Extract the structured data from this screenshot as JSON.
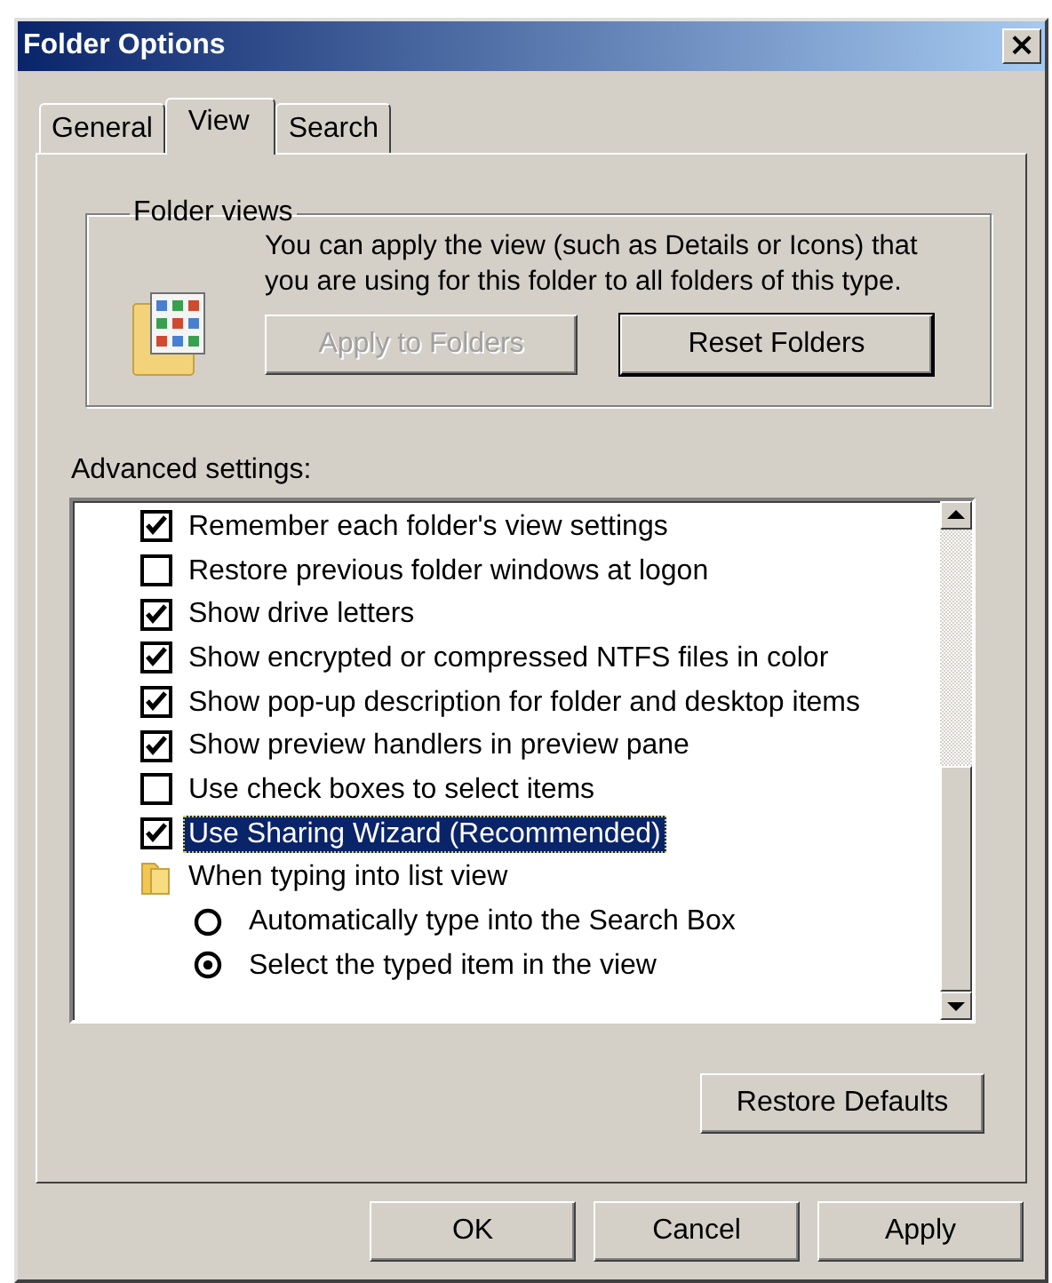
{
  "window": {
    "title": "Folder Options",
    "close": "×"
  },
  "tabs": [
    {
      "label": "General",
      "selected": false
    },
    {
      "label": "View",
      "selected": true
    },
    {
      "label": "Search",
      "selected": false
    }
  ],
  "folder_views": {
    "title": "Folder views",
    "description": "You can apply the view (such as Details or Icons) that you are using for this folder to all folders of this type.",
    "buttons": [
      {
        "label": "Apply to Folders",
        "disabled": true,
        "default": false
      },
      {
        "label": "Reset Folders",
        "disabled": false,
        "default": true
      }
    ]
  },
  "advanced": {
    "label": "Advanced settings:",
    "items": [
      {
        "kind": "checkbox",
        "label": "Remember each folder's view settings",
        "checked": true,
        "selected": false
      },
      {
        "kind": "checkbox",
        "label": "Restore previous folder windows at logon",
        "checked": false,
        "selected": false
      },
      {
        "kind": "checkbox",
        "label": "Show drive letters",
        "checked": true,
        "selected": false
      },
      {
        "kind": "checkbox",
        "label": "Show encrypted or compressed NTFS files in color",
        "checked": true,
        "selected": false
      },
      {
        "kind": "checkbox",
        "label": "Show pop-up description for folder and desktop items",
        "checked": true,
        "selected": false
      },
      {
        "kind": "checkbox",
        "label": "Show preview handlers in preview pane",
        "checked": true,
        "selected": false
      },
      {
        "kind": "checkbox",
        "label": "Use check boxes to select items",
        "checked": false,
        "selected": false
      },
      {
        "kind": "checkbox",
        "label": "Use Sharing Wizard (Recommended)",
        "checked": true,
        "selected": true
      },
      {
        "kind": "group",
        "label": "When typing into list view",
        "selected": false,
        "children": [
          {
            "kind": "radio",
            "label": "Automatically type into the Search Box",
            "checked": false,
            "selected": false
          },
          {
            "kind": "radio",
            "label": "Select the typed item in the view",
            "checked": true,
            "selected": false
          }
        ]
      }
    ],
    "restore_button": "Restore Defaults"
  },
  "buttons": [
    {
      "label": "OK"
    },
    {
      "label": "Cancel"
    },
    {
      "label": "Apply"
    }
  ]
}
